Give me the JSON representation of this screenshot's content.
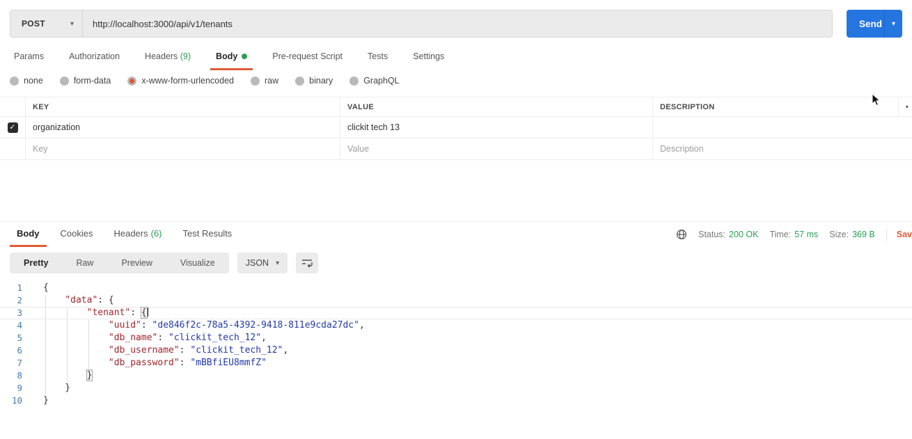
{
  "request": {
    "method": "POST",
    "url": "http://localhost:3000/api/v1/tenants",
    "send_label": "Send",
    "tabs": [
      {
        "label": "Params"
      },
      {
        "label": "Authorization"
      },
      {
        "label": "Headers",
        "count": "(9)"
      },
      {
        "label": "Body",
        "dot": true,
        "active": true
      },
      {
        "label": "Pre-request Script"
      },
      {
        "label": "Tests"
      },
      {
        "label": "Settings"
      }
    ],
    "body_modes": [
      "none",
      "form-data",
      "x-www-form-urlencoded",
      "raw",
      "binary",
      "GraphQL"
    ],
    "selected_mode": "x-www-form-urlencoded",
    "table": {
      "headers": [
        "KEY",
        "VALUE",
        "DESCRIPTION"
      ],
      "menu_icon": "•",
      "rows": [
        {
          "checked": true,
          "key": "organization",
          "value": "clickit tech 13",
          "description": ""
        }
      ],
      "placeholder": {
        "key": "Key",
        "value": "Value",
        "description": "Description"
      }
    }
  },
  "response": {
    "tabs": [
      {
        "label": "Body",
        "active": true
      },
      {
        "label": "Cookies"
      },
      {
        "label": "Headers",
        "count": "(6)"
      },
      {
        "label": "Test Results"
      }
    ],
    "meta": {
      "status_label": "Status:",
      "status_value": "200 OK",
      "time_label": "Time:",
      "time_value": "57 ms",
      "size_label": "Size:",
      "size_value": "369 B",
      "save_label": "Sav"
    },
    "view_tabs": [
      {
        "label": "Pretty",
        "active": true
      },
      {
        "label": "Raw"
      },
      {
        "label": "Preview"
      },
      {
        "label": "Visualize"
      }
    ],
    "format": "JSON",
    "code_lines": [
      {
        "n": "1",
        "seg": [
          [
            "cp",
            "{"
          ]
        ]
      },
      {
        "n": "2",
        "seg": [
          [
            "cp",
            "    "
          ],
          [
            "ck",
            "\"data\""
          ],
          [
            "cp",
            ": {"
          ]
        ]
      },
      {
        "n": "3",
        "active": true,
        "caret": true,
        "seg": [
          [
            "cp",
            "        "
          ],
          [
            "ck",
            "\"tenant\""
          ],
          [
            "cp",
            ": "
          ],
          [
            "cb",
            "{"
          ]
        ]
      },
      {
        "n": "4",
        "seg": [
          [
            "cp",
            "            "
          ],
          [
            "ck",
            "\"uuid\""
          ],
          [
            "cp",
            ": "
          ],
          [
            "cs",
            "\"de846f2c-78a5-4392-9418-811e9cda27dc\""
          ],
          [
            "cp",
            ","
          ]
        ]
      },
      {
        "n": "5",
        "seg": [
          [
            "cp",
            "            "
          ],
          [
            "ck",
            "\"db_name\""
          ],
          [
            "cp",
            ": "
          ],
          [
            "cs",
            "\"clickit_tech_12\""
          ],
          [
            "cp",
            ","
          ]
        ]
      },
      {
        "n": "6",
        "seg": [
          [
            "cp",
            "            "
          ],
          [
            "ck",
            "\"db_username\""
          ],
          [
            "cp",
            ": "
          ],
          [
            "cs",
            "\"clickit_tech_12\""
          ],
          [
            "cp",
            ","
          ]
        ]
      },
      {
        "n": "7",
        "seg": [
          [
            "cp",
            "            "
          ],
          [
            "ck",
            "\"db_password\""
          ],
          [
            "cp",
            ": "
          ],
          [
            "cs",
            "\"mBBfiEU8mmfZ\""
          ]
        ]
      },
      {
        "n": "8",
        "seg": [
          [
            "cp",
            "        "
          ],
          [
            "cb",
            "}"
          ]
        ]
      },
      {
        "n": "9",
        "seg": [
          [
            "cp",
            "    }"
          ]
        ]
      },
      {
        "n": "10",
        "seg": [
          [
            "cp",
            "}"
          ]
        ]
      }
    ]
  },
  "colors": {
    "accent_orange": "#e05b36",
    "success_green": "#27a052",
    "send_blue": "#2575e0",
    "code_key": "#a1262d",
    "code_string": "#2138a8",
    "line_number_blue": "#4878a8"
  }
}
